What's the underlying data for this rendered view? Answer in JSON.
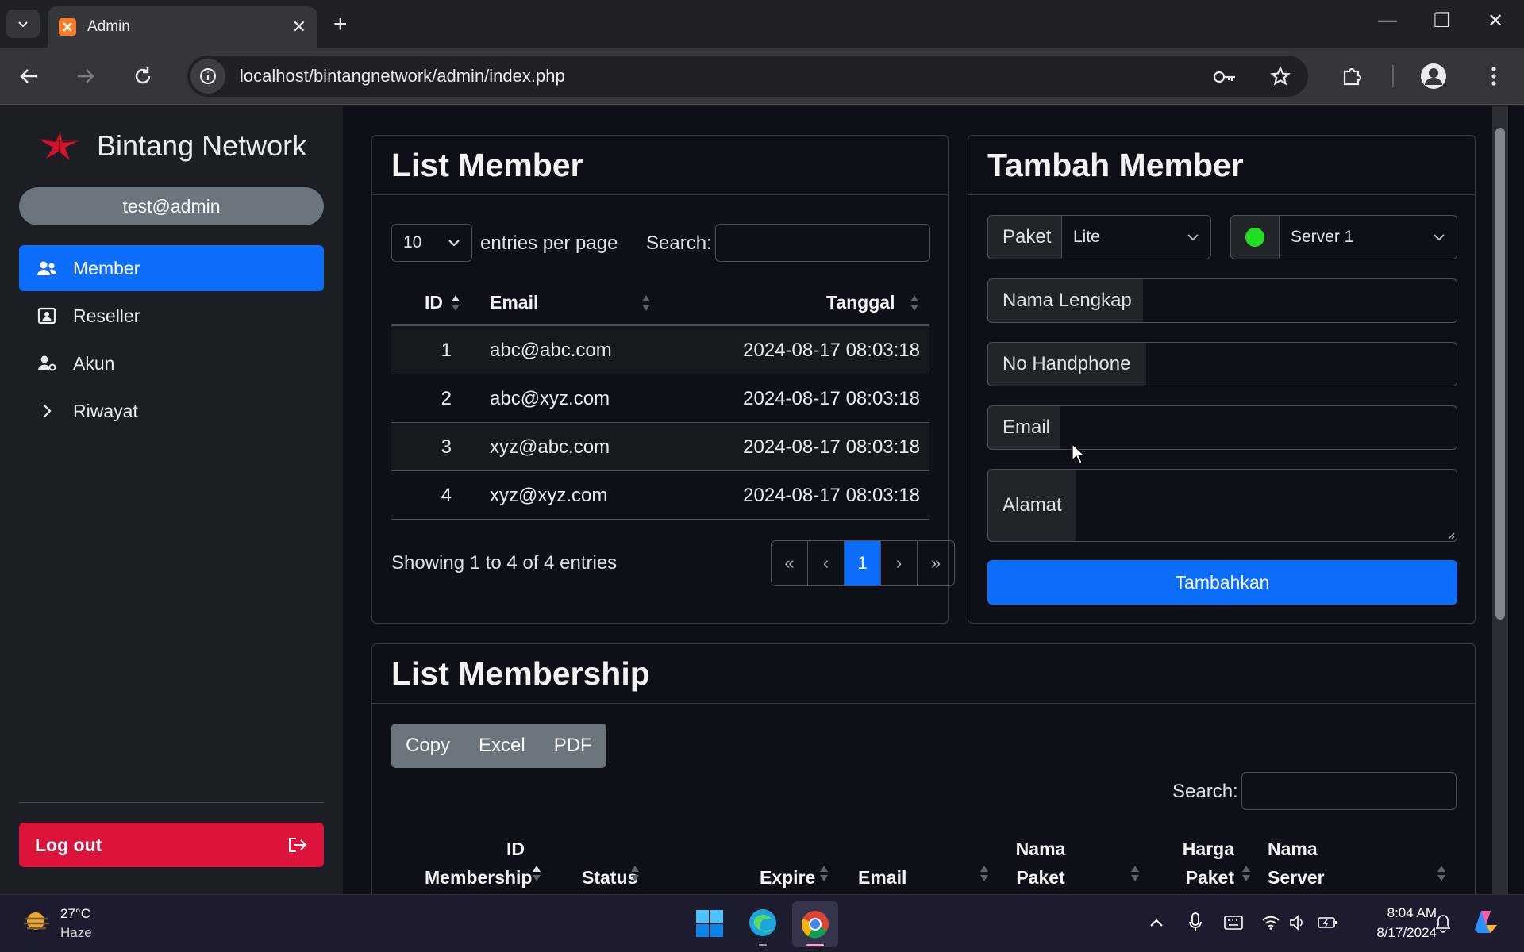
{
  "browser": {
    "tab_title": "Admin",
    "url": "localhost/bintangnetwork/admin/index.php"
  },
  "sidebar": {
    "brand": "Bintang Network",
    "user": "test@admin",
    "items": [
      {
        "label": "Member",
        "icon": "users-icon",
        "active": true
      },
      {
        "label": "Reseller",
        "icon": "id-card-icon",
        "active": false
      },
      {
        "label": "Akun",
        "icon": "user-gear-icon",
        "active": false
      },
      {
        "label": "Riwayat",
        "icon": "chevron-right-icon",
        "active": false
      }
    ],
    "logout": "Log out"
  },
  "list_member": {
    "title": "List Member",
    "entries_value": "10",
    "entries_label": "entries per page",
    "search_label": "Search:",
    "columns": [
      "ID",
      "Email",
      "Tanggal"
    ],
    "rows": [
      {
        "id": "1",
        "email": "abc@abc.com",
        "tanggal": "2024-08-17 08:03:18"
      },
      {
        "id": "2",
        "email": "abc@xyz.com",
        "tanggal": "2024-08-17 08:03:18"
      },
      {
        "id": "3",
        "email": "xyz@abc.com",
        "tanggal": "2024-08-17 08:03:18"
      },
      {
        "id": "4",
        "email": "xyz@xyz.com",
        "tanggal": "2024-08-17 08:03:18"
      }
    ],
    "info": "Showing 1 to 4 of 4 entries",
    "pager": {
      "first": "«",
      "prev": "‹",
      "current": "1",
      "next": "›",
      "last": "»"
    }
  },
  "tambah_member": {
    "title": "Tambah Member",
    "paket_label": "Paket",
    "paket_value": "Lite",
    "server_value": "Server 1",
    "server_status_color": "#22dd22",
    "nama_label": "Nama Lengkap",
    "hp_label": "No Handphone",
    "email_label": "Email",
    "alamat_label": "Alamat",
    "submit": "Tambahkan"
  },
  "list_membership": {
    "title": "List Membership",
    "buttons": [
      "Copy",
      "Excel",
      "PDF"
    ],
    "search_label": "Search:",
    "columns": [
      {
        "line1": "ID",
        "line2": "Membership"
      },
      {
        "line1": "",
        "line2": "Status"
      },
      {
        "line1": "",
        "line2": "Expire"
      },
      {
        "line1": "",
        "line2": "Email"
      },
      {
        "line1": "Nama",
        "line2": "Paket"
      },
      {
        "line1": "Harga",
        "line2": "Paket"
      },
      {
        "line1": "Nama",
        "line2": "Server"
      }
    ]
  },
  "taskbar": {
    "temp": "27°C",
    "weather": "Haze",
    "time": "8:04 AM",
    "date": "8/17/2024"
  },
  "colors": {
    "accent": "#0d6efd",
    "danger": "#dc143c",
    "brand_star": "#d1142b"
  }
}
